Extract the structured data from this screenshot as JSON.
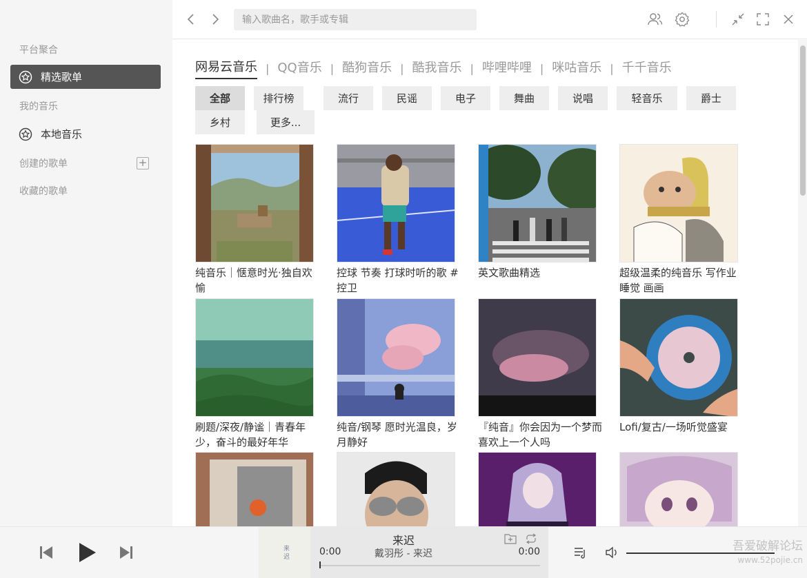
{
  "sidebar": {
    "section_platform": "平台聚合",
    "item_selected": "精选歌单",
    "section_my_music": "我的音乐",
    "item_local": "本地音乐",
    "section_created": "创建的歌单",
    "section_collected": "收藏的歌单"
  },
  "search": {
    "placeholder": "输入歌曲名，歌手或专辑"
  },
  "platforms": [
    "网易云音乐",
    "QQ音乐",
    "酷狗音乐",
    "酷我音乐",
    "哔哩哔哩",
    "咪咕音乐",
    "千千音乐"
  ],
  "active_platform": "网易云音乐",
  "categories": [
    "全部",
    "排行榜",
    "流行",
    "民谣",
    "电子",
    "舞曲",
    "说唱",
    "轻音乐",
    "爵士",
    "乡村",
    "更多..."
  ],
  "active_category": "全部",
  "playlists": [
    {
      "title": "纯音乐｜惬意时光·独自欢愉"
    },
    {
      "title": "控球 节奏 打球时听的歌 # 控卫"
    },
    {
      "title": "英文歌曲精选"
    },
    {
      "title": "超级温柔的纯音乐 写作业 睡觉 画画"
    },
    {
      "title": "刷题/深夜/静谧｜青春年少，奋斗的最好年华"
    },
    {
      "title": "纯音/钢琴 愿时光温良，岁月静好"
    },
    {
      "title": "『纯音』你会因为一个梦而喜欢上一个人吗"
    },
    {
      "title": "Lofi/复古/一场听觉盛宴"
    },
    {
      "title": ""
    },
    {
      "title": ""
    },
    {
      "title": ""
    },
    {
      "title": ""
    }
  ],
  "player": {
    "song_title": "来迟",
    "song_sub": "戴羽彤 - 来迟",
    "time_current": "0:00",
    "time_total": "0:00",
    "progress": 0,
    "volume": 1.0,
    "cover_text": "来迟"
  },
  "watermark": {
    "line1": "吾爱破解论坛",
    "line2": "www.52pojie.cn"
  },
  "colors": {
    "active_nav": "#555555",
    "sidebar_bg": "#f5f5f5",
    "chip_bg": "#eeeeee"
  }
}
